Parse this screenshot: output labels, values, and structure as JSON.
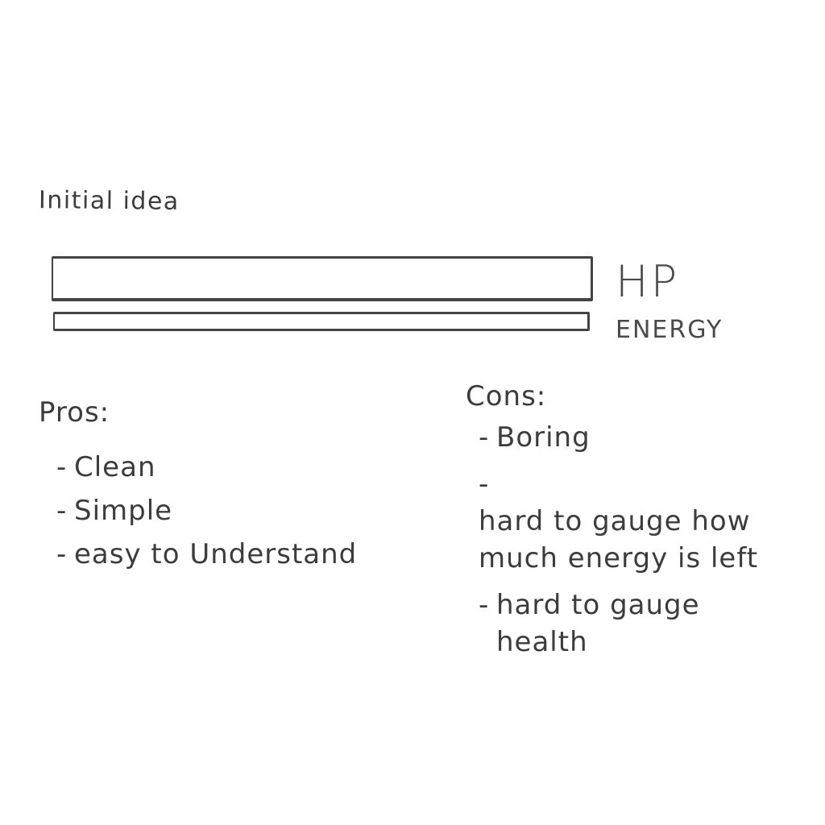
{
  "title": "Initial idea",
  "bars": {
    "hp_label": "HP",
    "energy_label": "ENERGY"
  },
  "pros": {
    "heading": "Pros:",
    "items": [
      "Clean",
      "Simple",
      "easy to Understand"
    ]
  },
  "cons": {
    "heading": "Cons:",
    "items": [
      "Boring",
      "hard to gauge how much energy is left",
      "hard to gauge health"
    ]
  },
  "list_marker": "-"
}
